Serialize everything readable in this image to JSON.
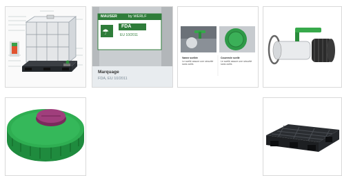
{
  "tiles": [
    {
      "id": "ibc-diagram",
      "label": "IBC container diagram"
    },
    {
      "id": "marquage",
      "title": "Marquage",
      "subtitle": "FDA, EU 10/2011",
      "plate_brand": "MAUSER",
      "plate_brand2": "by WERLF",
      "plate_code": "FDA",
      "plate_code2": "EU 10/2011"
    },
    {
      "id": "valve-lid",
      "left_title": "Vanne scellée",
      "left_text": "Le scellé assure une sécurité",
      "left_text2": "sans outils",
      "right_title": "Couvercle scellé",
      "right_text": "Le scellé assure une sécurité",
      "right_text2": "sans outils"
    },
    {
      "id": "valve-adapter",
      "label": "Butterfly valve with adapter"
    },
    {
      "id": "green-lid",
      "label": "Green screw lid"
    },
    {
      "id": "pallet",
      "label": "Black plastic pallet"
    }
  ]
}
